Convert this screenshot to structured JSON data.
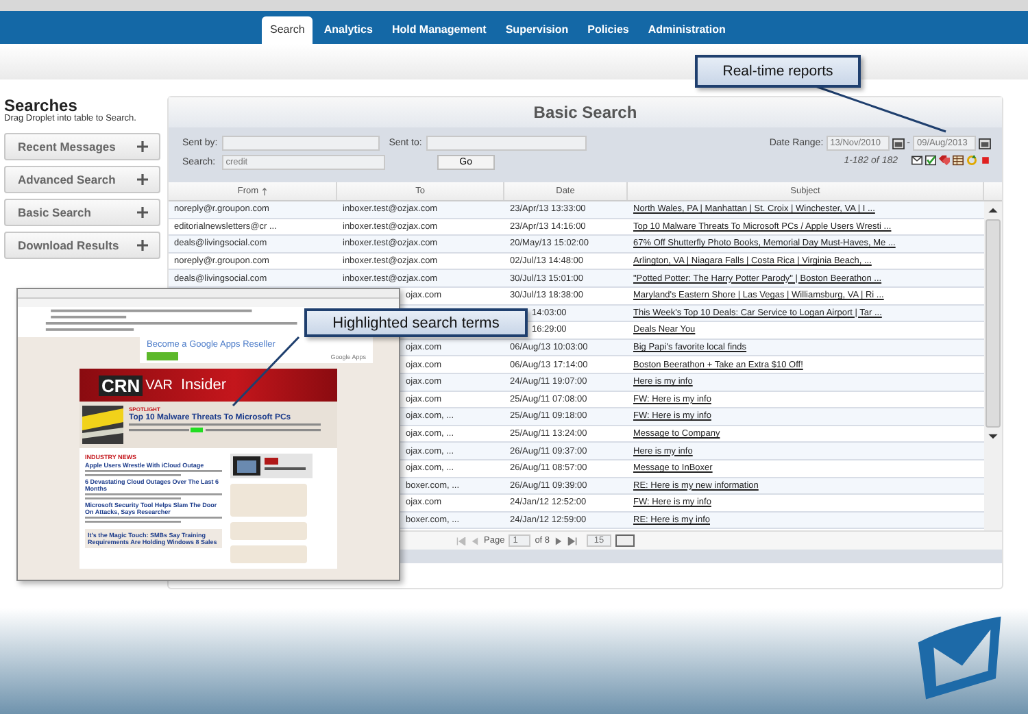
{
  "nav_tabs": [
    {
      "label": "Search",
      "selected": true
    },
    {
      "label": "Analytics",
      "selected": false
    },
    {
      "label": "Hold Management",
      "selected": false
    },
    {
      "label": "Supervision",
      "selected": false
    },
    {
      "label": "Policies",
      "selected": false
    },
    {
      "label": "Administration",
      "selected": false
    }
  ],
  "sidebar": {
    "title": "Searches",
    "subtitle": "Drag Droplet into table to Search.",
    "items": [
      "Recent Messages",
      "Advanced Search",
      "Basic Search",
      "Download Results"
    ]
  },
  "panel": {
    "title": "Basic Search",
    "sent_by_label": "Sent by:",
    "sent_to_label": "Sent to:",
    "search_label": "Search:",
    "search_value": "credit",
    "go_button": "Go",
    "date_range_label": "Date Range:",
    "date_from": "13/Nov/2010",
    "date_separator": "-",
    "date_to": "09/Aug/2013",
    "result_count": "1-182 of 182"
  },
  "table": {
    "columns": [
      {
        "label": "From",
        "sorted": true
      },
      {
        "label": "To",
        "sorted": false
      },
      {
        "label": "Date",
        "sorted": false
      },
      {
        "label": "Subject",
        "sorted": false
      }
    ],
    "rows": [
      {
        "from": "noreply@r.groupon.com",
        "to": "inboxer.test@ozjax.com",
        "date": "23/Apr/13 13:33:00",
        "subject": "North Wales, PA | Manhattan | St. Croix | Winchester, VA | I ..."
      },
      {
        "from": "editorialnewsletters@cr ...",
        "to": "inboxer.test@ozjax.com",
        "date": "23/Apr/13 14:16:00",
        "subject": "Top 10 Malware Threats To Microsoft PCs / Apple Users Wresti ..."
      },
      {
        "from": "deals@livingsocial.com",
        "to": "inboxer.test@ozjax.com",
        "date": "20/May/13 15:02:00",
        "subject": "67% Off Shutterfly Photo Books, Memorial Day Must-Haves, Me ..."
      },
      {
        "from": "noreply@r.groupon.com",
        "to": "inboxer.test@ozjax.com",
        "date": "02/Jul/13 14:48:00",
        "subject": "Arlington, VA | Niagara Falls | Costa Rica | Virginia Beach, ..."
      },
      {
        "from": "deals@livingsocial.com",
        "to": "inboxer.test@ozjax.com",
        "date": "30/Jul/13 15:01:00",
        "subject": "\"Potted Potter: The Harry Potter Parody\" | Boston Beerathon ..."
      },
      {
        "to": "ojax.com",
        "date": "30/Jul/13 18:38:00",
        "subject": "Maryland's Eastern Shore | Las Vegas | Williamsburg, VA | Ri ..."
      },
      {
        "date": "14:03:00",
        "subject": "This Week's Top 10 Deals: Car Service to Logan Airport | Tar ..."
      },
      {
        "date": "16:29:00",
        "subject": "Deals Near You"
      },
      {
        "to": "ojax.com",
        "date": "06/Aug/13 10:03:00",
        "subject": "Big Papi's favorite local finds"
      },
      {
        "to": "ojax.com",
        "date": "06/Aug/13 17:14:00",
        "subject": "Boston Beerathon + Take an Extra $10 Off!"
      },
      {
        "to": "ojax.com",
        "date": "24/Aug/11 19:07:00",
        "subject": "Here is my info"
      },
      {
        "to": "ojax.com",
        "date": "25/Aug/11 07:08:00",
        "subject": "FW: Here is my info"
      },
      {
        "to": "ojax.com, ...",
        "date": "25/Aug/11 09:18:00",
        "subject": "FW: Here is my info"
      },
      {
        "to": "ojax.com, ...",
        "date": "25/Aug/11 13:24:00",
        "subject": "Message to Company"
      },
      {
        "to": "ojax.com, ...",
        "date": "26/Aug/11 09:37:00",
        "subject": "Here is my info"
      },
      {
        "to": "ojax.com, ...",
        "date": "26/Aug/11 08:57:00",
        "subject": "Message to InBoxer"
      },
      {
        "to": "boxer.com, ...",
        "date": "26/Aug/11 09:39:00",
        "subject": "RE: Here is my new information"
      },
      {
        "to": "ojax.com",
        "date": "24/Jan/12 12:52:00",
        "subject": "FW: Here is my info"
      },
      {
        "to": "boxer.com, ...",
        "date": "24/Jan/12 12:59:00",
        "subject": "RE: Here is my info"
      }
    ]
  },
  "pager": {
    "page_label": "Page",
    "page": "1",
    "of_label": "of 8",
    "page_size": "15"
  },
  "email_preview": {
    "ad_text": "Become a Google Apps Reseller",
    "ad_brand": "Google Apps",
    "logo": "CRN",
    "title_left": "VAR",
    "title_right": "Insider",
    "spotlight_label": "SPOTLIGHT",
    "spotlight_headline": "Top 10 Malware Threats To Microsoft PCs",
    "section_label": "INDUSTRY NEWS",
    "headlines": [
      "Apple Users Wrestle With iCloud Outage",
      "6 Devastating Cloud Outages Over The Last 6 Months",
      "Microsoft Security Tool Helps Slam The Door On Attacks, Says Researcher"
    ],
    "featured_headline": "It's the Magic Touch: SMBs Say Training Requirements Are Holding Windows 8 Sales"
  },
  "callouts": [
    {
      "text": "Real-time reports"
    },
    {
      "text": "Highlighted search terms"
    }
  ]
}
